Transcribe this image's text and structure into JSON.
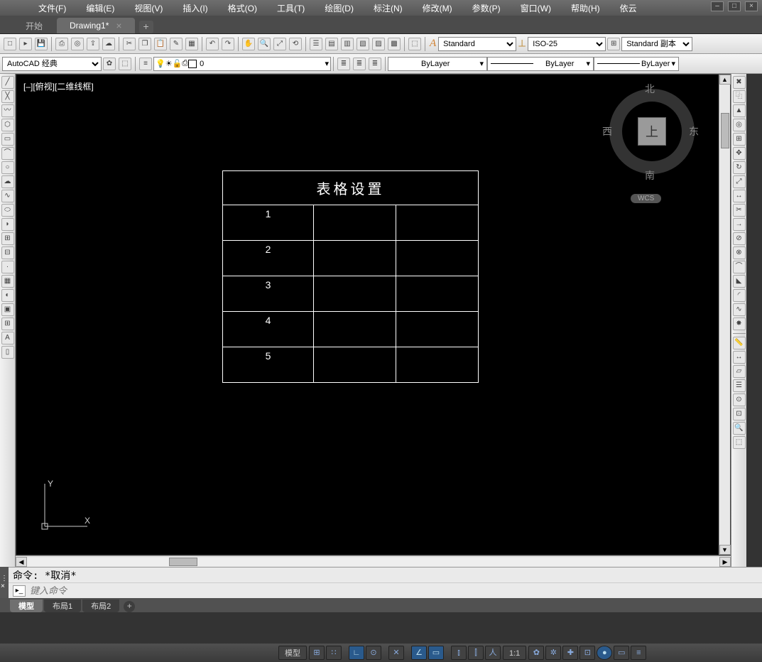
{
  "menu": {
    "items": [
      "文件(F)",
      "编辑(E)",
      "视图(V)",
      "插入(I)",
      "格式(O)",
      "工具(T)",
      "绘图(D)",
      "标注(N)",
      "修改(M)",
      "参数(P)",
      "窗口(W)",
      "帮助(H)",
      "依云"
    ]
  },
  "tabs": {
    "start": "开始",
    "drawing": "Drawing1*"
  },
  "styles": {
    "textstyle": "Standard",
    "dimstyle": "ISO-25",
    "tablestyle": "Standard 副本"
  },
  "workspace": "AutoCAD 经典",
  "layerctrl": "0",
  "colorctrl": "ByLayer",
  "ltypectrl": "ByLayer",
  "lwctrl": "ByLayer",
  "viewlabel": "[–][俯视][二维线框]",
  "table": {
    "title": "表格设置",
    "rows": [
      "1",
      "2",
      "3",
      "4",
      "5"
    ]
  },
  "viewcube": {
    "n": "北",
    "s": "南",
    "e": "东",
    "w": "西",
    "top": "上",
    "wcs": "WCS"
  },
  "cmd": {
    "line": "命令:  *取消*",
    "placeholder": "键入命令"
  },
  "layouts": {
    "model": "模型",
    "l1": "布局1",
    "l2": "布局2"
  },
  "status": {
    "model": "模型",
    "scale": "1:1"
  }
}
